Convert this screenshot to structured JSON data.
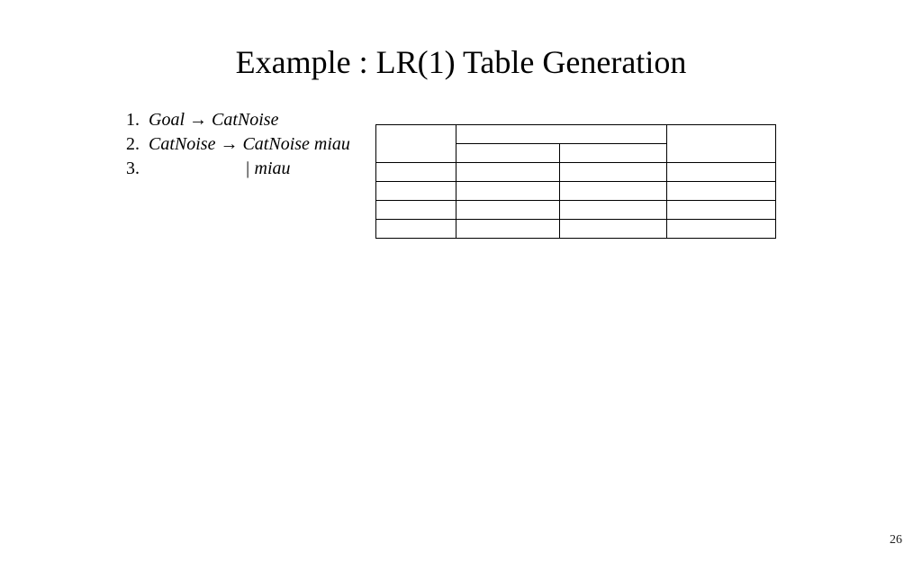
{
  "title": "Example : LR(1) Table Generation",
  "grammar": {
    "r1": {
      "num": "1.",
      "lhs": "Goal",
      "arrow": "→",
      "rhs": "CatNoise"
    },
    "r2": {
      "num": "2.",
      "lhs": "CatNoise",
      "arrow": "→",
      "rhs": "CatNoise miau"
    },
    "r3": {
      "num": "3.",
      "bar": "|",
      "rhs": "miau"
    }
  },
  "page_number": "26"
}
